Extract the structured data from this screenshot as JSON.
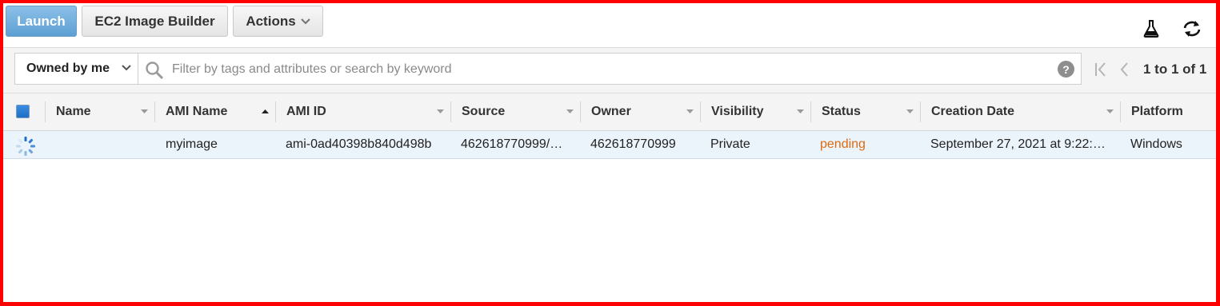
{
  "toolbar": {
    "launch_label": "Launch",
    "image_builder_label": "EC2 Image Builder",
    "actions_label": "Actions",
    "icons": [
      "flask-icon",
      "refresh-icon"
    ]
  },
  "filter": {
    "owner_select": "Owned by me",
    "search_placeholder": "Filter by tags and attributes or search by keyword",
    "help_symbol": "?",
    "pagination": "1 to 1 of 1"
  },
  "table": {
    "columns": [
      "Name",
      "AMI Name",
      "AMI ID",
      "Source",
      "Owner",
      "Visibility",
      "Status",
      "Creation Date",
      "Platform"
    ],
    "rows": [
      {
        "name": "",
        "ami_name": "myimage",
        "ami_id": "ami-0ad40398b840d498b",
        "source": "462618770999/…",
        "owner": "462618770999",
        "visibility": "Private",
        "status": "pending",
        "creation_date": "September 27, 2021 at 9:22:…",
        "platform": "Windows"
      }
    ]
  },
  "colors": {
    "frame": "#ff0000",
    "launch_button": "#5d9fd3",
    "selected_row": "#ebf3fb",
    "status_pending": "#dd6b10"
  }
}
